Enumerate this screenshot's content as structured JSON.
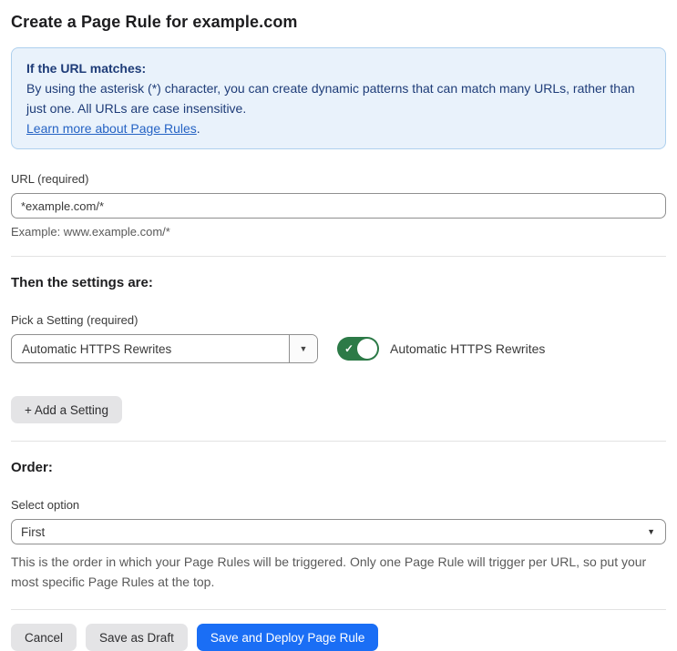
{
  "page": {
    "title": "Create a Page Rule for example.com"
  },
  "info_box": {
    "heading": "If the URL matches:",
    "body": "By using the asterisk (*) character, you can create dynamic patterns that can match many URLs, rather than just one. All URLs are case insensitive.",
    "link_text": "Learn more about Page Rules",
    "link_suffix": "."
  },
  "url_field": {
    "label": "URL (required)",
    "value": "*example.com/*",
    "helper": "Example: www.example.com/*"
  },
  "settings_section": {
    "heading": "Then the settings are:",
    "picker_label": "Pick a Setting (required)",
    "picker_value": "Automatic HTTPS Rewrites",
    "toggle_state": "on",
    "toggle_check": "✓",
    "toggle_label": "Automatic HTTPS Rewrites",
    "add_setting_label": "+ Add a Setting"
  },
  "order_section": {
    "heading": "Order:",
    "select_label": "Select option",
    "select_value": "First",
    "helper": "This is the order in which your Page Rules will be triggered. Only one Page Rule will trigger per URL, so put your most specific Page Rules at the top."
  },
  "footer": {
    "cancel_label": "Cancel",
    "save_draft_label": "Save as Draft",
    "save_deploy_label": "Save and Deploy Page Rule"
  },
  "icons": {
    "dropdown_arrow": "▼",
    "select_arrow": "▼"
  },
  "colors": {
    "accent_blue": "#1a6ef5",
    "toggle_green": "#2c7a47",
    "info_bg": "#e9f2fb",
    "info_border": "#aed0ee",
    "info_text": "#1e3c78",
    "link_blue": "#2563c4"
  }
}
